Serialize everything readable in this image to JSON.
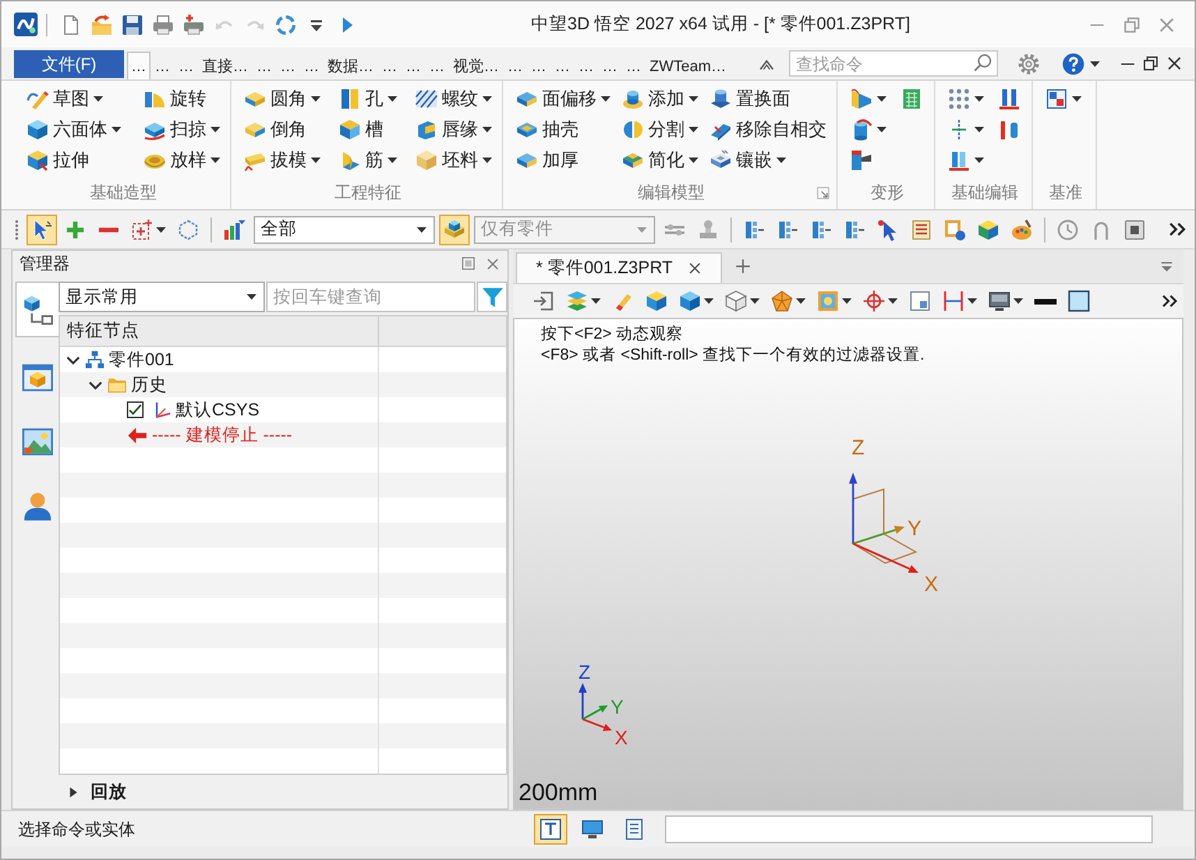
{
  "title_bar": {
    "title": "中望3D 悟空 2027 x64 试用 - [* 零件001.Z3PRT]",
    "quick_access": [
      {
        "disabled": false
      },
      {
        "disabled": false
      },
      {
        "disabled": false
      },
      {
        "disabled": false
      },
      {
        "disabled": false
      },
      {
        "disabled": true
      },
      {
        "disabled": true
      },
      {
        "disabled": false
      },
      {
        "disabled": false
      },
      {
        "disabled": false
      }
    ]
  },
  "menu_bar": {
    "file_button": "文件(F)",
    "tabs": [
      {
        "label": "…",
        "selected": true
      },
      {
        "label": "…",
        "selected": false
      },
      {
        "label": "…",
        "selected": false
      },
      {
        "label": "直接…",
        "selected": false
      },
      {
        "label": "…",
        "selected": false
      },
      {
        "label": "…",
        "selected": false
      },
      {
        "label": "…",
        "selected": false
      },
      {
        "label": "数据…",
        "selected": false
      },
      {
        "label": "…",
        "selected": false
      },
      {
        "label": "…",
        "selected": false
      },
      {
        "label": "…",
        "selected": false
      },
      {
        "label": "视觉…",
        "selected": false
      },
      {
        "label": "…",
        "selected": false
      },
      {
        "label": "…",
        "selected": false
      },
      {
        "label": "…",
        "selected": false
      },
      {
        "label": "…",
        "selected": false
      },
      {
        "label": "…",
        "selected": false
      },
      {
        "label": "…",
        "selected": false
      },
      {
        "label": "ZWTeam…",
        "selected": false
      }
    ],
    "search": {
      "placeholder": "查找命令"
    }
  },
  "ribbon": {
    "groups": [
      {
        "title": "基础造型",
        "launcher": false,
        "rows": [
          [
            {
              "label": "草图",
              "dropdown": true
            },
            {
              "label": "旋转",
              "dropdown": false
            }
          ],
          [
            {
              "label": "六面体",
              "dropdown": true
            },
            {
              "label": "扫掠",
              "dropdown": true
            }
          ],
          [
            {
              "label": "拉伸",
              "dropdown": false
            },
            {
              "label": "放样",
              "dropdown": true
            }
          ]
        ]
      },
      {
        "title": "工程特征",
        "launcher": false,
        "rows": [
          [
            {
              "label": "圆角",
              "dropdown": true
            },
            {
              "label": "孔",
              "dropdown": true
            },
            {
              "label": "螺纹",
              "dropdown": true
            }
          ],
          [
            {
              "label": "倒角",
              "dropdown": false
            },
            {
              "label": "槽",
              "dropdown": false
            },
            {
              "label": "唇缘",
              "dropdown": true
            }
          ],
          [
            {
              "label": "拔模",
              "dropdown": true
            },
            {
              "label": "筋",
              "dropdown": true
            },
            {
              "label": "坯料",
              "dropdown": true
            }
          ]
        ]
      },
      {
        "title": "编辑模型",
        "launcher": true,
        "rows": [
          [
            {
              "label": "面偏移",
              "dropdown": true
            },
            {
              "label": "添加",
              "dropdown": true
            },
            {
              "label": "置换面",
              "dropdown": false
            }
          ],
          [
            {
              "label": "抽壳",
              "dropdown": false
            },
            {
              "label": "分割",
              "dropdown": true
            },
            {
              "label": "移除自相交",
              "dropdown": false
            }
          ],
          [
            {
              "label": "加厚",
              "dropdown": false
            },
            {
              "label": "简化",
              "dropdown": true
            },
            {
              "label": "镶嵌",
              "dropdown": true
            }
          ]
        ]
      },
      {
        "title": "变形",
        "launcher": false,
        "rows": [
          [
            {
              "dropdown": true
            },
            {
              "dropdown": false
            }
          ],
          [
            {
              "dropdown": true
            }
          ],
          [
            {
              "dropdown": false
            }
          ]
        ]
      },
      {
        "title": "基础编辑",
        "launcher": false,
        "rows": [
          [
            {
              "dropdown": true
            },
            {
              "dropdown": false
            }
          ],
          [
            {
              "dropdown": true
            },
            {
              "dropdown": false
            }
          ],
          [
            {
              "dropdown": true
            }
          ]
        ]
      },
      {
        "title": "基准",
        "launcher": false,
        "rows": [
          [
            {
              "dropdown": true
            }
          ]
        ]
      }
    ]
  },
  "toolbar": {
    "groups": [
      [
        {
          "kind": "button",
          "selected": true,
          "dropdown": false
        },
        {
          "kind": "button",
          "selected": false,
          "dropdown": false
        },
        {
          "kind": "button",
          "selected": false,
          "dropdown": false
        },
        {
          "kind": "button",
          "selected": false,
          "dropdown": true
        },
        {
          "kind": "button",
          "selected": false,
          "dropdown": false
        }
      ],
      [
        {
          "kind": "button",
          "selected": false,
          "dropdown": false
        },
        {
          "kind": "combo",
          "value": "全部",
          "disabled": false
        },
        {
          "kind": "button",
          "selected": true,
          "dropdown": false
        },
        {
          "kind": "combo",
          "value": "仅有零件",
          "disabled": true
        },
        {
          "kind": "button",
          "selected": false,
          "dropdown": false
        },
        {
          "kind": "button",
          "selected": false,
          "dropdown": false
        }
      ],
      [
        {
          "kind": "button",
          "selected": false,
          "dropdown": false
        },
        {
          "kind": "button",
          "selected": false,
          "dropdown": false
        },
        {
          "kind": "button",
          "selected": false,
          "dropdown": false
        },
        {
          "kind": "button",
          "selected": false,
          "dropdown": false
        },
        {
          "kind": "button",
          "selected": false,
          "dropdown": false
        },
        {
          "kind": "button",
          "selected": false,
          "dropdown": false
        },
        {
          "kind": "button",
          "selected": false,
          "dropdown": false
        },
        {
          "kind": "button",
          "selected": false,
          "dropdown": false
        },
        {
          "kind": "button",
          "selected": false,
          "dropdown": false
        }
      ],
      [
        {
          "kind": "button",
          "selected": false,
          "dropdown": false
        },
        {
          "kind": "button",
          "selected": false,
          "dropdown": false
        },
        {
          "kind": "button",
          "selected": false,
          "dropdown": false
        }
      ]
    ]
  },
  "manager": {
    "title": "管理器",
    "side_tabs": [
      {
        "selected": true
      },
      {
        "selected": false
      },
      {
        "selected": false
      },
      {
        "selected": false
      }
    ],
    "filter": {
      "value": "显示常用"
    },
    "search": {
      "placeholder": "按回车键查询"
    },
    "tree": {
      "columns": [
        "特征节点"
      ],
      "nodes": [
        {
          "label": "零件001",
          "kind": "part",
          "expanded": true,
          "children": [
            {
              "label": "历史",
              "kind": "folder",
              "expanded": true,
              "children": [
                {
                  "label": "默认CSYS",
                  "kind": "feature",
                  "checked": true
                },
                {
                  "label": "----- 建模停止 -----",
                  "kind": "marker"
                }
              ]
            }
          ]
        }
      ]
    },
    "replay": {
      "label": "回放",
      "expanded": false
    }
  },
  "document_tabs": [
    {
      "label": "* 零件001.Z3PRT",
      "selected": true
    }
  ],
  "view_toolbar": {
    "items": [
      {
        "dropdown": false
      },
      {
        "dropdown": true
      },
      {
        "dropdown": false
      },
      {
        "dropdown": false
      },
      {
        "dropdown": true
      },
      {
        "dropdown": true
      },
      {
        "dropdown": true
      },
      {
        "dropdown": true
      },
      {
        "dropdown": true
      },
      {
        "dropdown": false
      },
      {
        "dropdown": true
      },
      {
        "dropdown": true
      },
      {
        "dropdown": false
      },
      {
        "dropdown": false
      }
    ]
  },
  "viewport": {
    "hints": [
      "按下<F2> 动态观察",
      "<F8> 或者 <Shift-roll> 查找下一个有效的过滤器设置."
    ],
    "triad": {
      "x": "X",
      "y": "Y",
      "z": "Z"
    },
    "view_triad": {
      "x": "X",
      "y": "Y",
      "z": "Z"
    },
    "scale": "200mm"
  },
  "status_bar": {
    "message": "选择命令或实体",
    "buttons": [
      {
        "selected": true
      },
      {
        "selected": false
      },
      {
        "selected": false
      }
    ]
  }
}
